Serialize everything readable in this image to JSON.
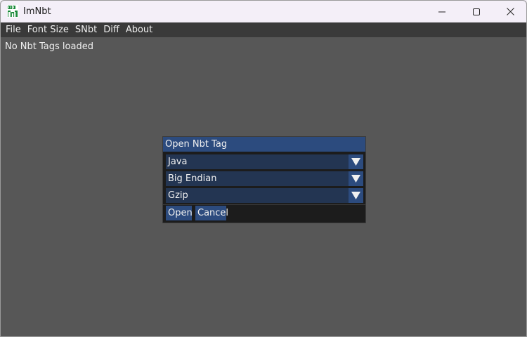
{
  "window": {
    "title": "ImNbt",
    "app_icon": "nbt-logo-icon",
    "controls": {
      "minimize_icon": "minimize-icon",
      "maximize_icon": "maximize-icon",
      "close_icon": "close-icon"
    }
  },
  "menubar": {
    "items": [
      {
        "label": "File"
      },
      {
        "label": "Font Size"
      },
      {
        "label": "SNbt"
      },
      {
        "label": "Diff"
      },
      {
        "label": "About"
      }
    ]
  },
  "main": {
    "status": "No Nbt Tags loaded"
  },
  "dialog": {
    "title": "Open Nbt Tag",
    "edition_select": {
      "value": "Java"
    },
    "endian_select": {
      "value": "Big Endian"
    },
    "compression_select": {
      "value": "Gzip"
    },
    "open_label": "Open",
    "cancel_label": "Cancel"
  },
  "colors": {
    "background": "#575757",
    "menubar": "#3a3a3a",
    "accent": "#2c4b7e",
    "frame": "#233552",
    "dialog_bg": "#1c1c1c",
    "text": "#f0f0f0"
  }
}
